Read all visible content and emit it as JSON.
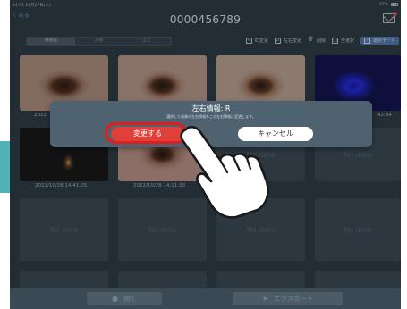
{
  "status_bar": {
    "time": "14:51 10月27日(木)",
    "battery": "87%"
  },
  "nav": {
    "back_label": "く 戻る",
    "title": "0000456789",
    "mail_icon": "mail-close-icon"
  },
  "segments": [
    {
      "label": "眼底画",
      "selected": true
    },
    {
      "label": "前眼",
      "selected": false
    },
    {
      "label": "全て",
      "selected": false
    }
  ],
  "toolbar": [
    {
      "label": "ID変更",
      "icon": "edit-icon"
    },
    {
      "label": "左右変更",
      "icon": "swap-icon"
    },
    {
      "label": "削除",
      "icon": "trash-icon"
    },
    {
      "label": "全選択",
      "icon": "select-all-icon"
    },
    {
      "label": "選択モード",
      "icon": "checkbox-icon",
      "active": true
    }
  ],
  "grid": {
    "partial_caption_left": "2022",
    "partial_caption_right": "42:34",
    "photo_captions": [
      "2022/10/28 14:41:25",
      "2022/10/28 14:11:23"
    ],
    "no_data_label": "No data"
  },
  "dialog": {
    "title": "左右情報: R",
    "subtitle": "選択した画像の左右情報をこの左右情報に変更します。",
    "confirm_label": "変更する",
    "cancel_label": "キャンセル"
  },
  "bottom_bar": {
    "open_label": "開く",
    "export_label": "エクスポート"
  },
  "colors": {
    "background": "#2f3c45",
    "confirm": "#e0403a",
    "highlight_ring": "#e31c1c",
    "accent_tab": "#4fb3b8",
    "select_mode": "#5b88c4"
  }
}
